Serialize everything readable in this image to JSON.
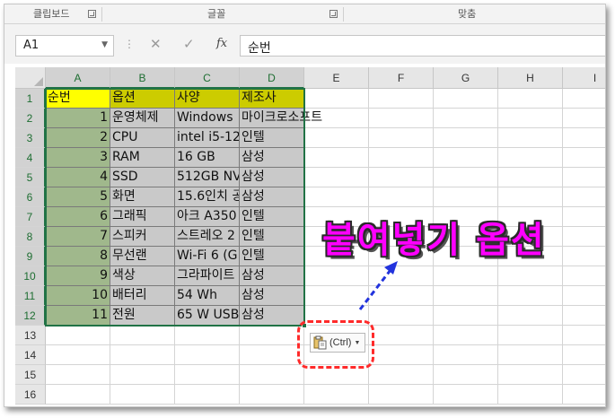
{
  "ribbon": {
    "groups": [
      "클립보드",
      "글꼴",
      "맞춤"
    ]
  },
  "formula_bar": {
    "name_box": "A1",
    "cancel_symbol": "✕",
    "enter_symbol": "✓",
    "fx_label": "fx",
    "content": "순번"
  },
  "sheet": {
    "columns": [
      "A",
      "B",
      "C",
      "D",
      "E",
      "F",
      "G",
      "H",
      "I"
    ],
    "rows": [
      "1",
      "2",
      "3",
      "4",
      "5",
      "6",
      "7",
      "8",
      "9",
      "10",
      "11",
      "12",
      "13",
      "14",
      "15",
      "16"
    ],
    "header_row": [
      "순번",
      "옵션",
      "사양",
      "제조사"
    ],
    "data": [
      [
        "1",
        "운영체제",
        "Windows",
        "마이크로소프트"
      ],
      [
        "2",
        "CPU",
        "intel i5-12",
        "인텔"
      ],
      [
        "3",
        "RAM",
        "16 GB",
        "삼성"
      ],
      [
        "4",
        "SSD",
        "512GB NV",
        "삼성"
      ],
      [
        "5",
        "화면",
        "15.6인치 공",
        "삼성"
      ],
      [
        "6",
        "그래픽",
        "아크 A350",
        "인텔"
      ],
      [
        "7",
        "스피커",
        "스트레오 2",
        "인텔"
      ],
      [
        "8",
        "무선랜",
        "Wi-Fi 6 (G",
        "인텔"
      ],
      [
        "9",
        "색상",
        "그라파이트",
        "삼성"
      ],
      [
        "10",
        "배터리",
        "54 Wh",
        "삼성"
      ],
      [
        "11",
        "전원",
        "65 W USB",
        "삼성"
      ]
    ]
  },
  "paste_options": {
    "label": "(Ctrl)",
    "icon": "clipboard-paste-icon"
  },
  "annotation": {
    "callout_text": "붙여넣기 옵션",
    "callout_color": "#ff00ff",
    "ring_color": "#ff2a2a",
    "arrow_color": "#2233dd"
  },
  "colors": {
    "header_yellow": "#ffff00",
    "header_olive": "#cccc00",
    "column_a_green": "#a0b88c",
    "body_gray": "#c9c9c9",
    "selection_green": "#217346"
  }
}
